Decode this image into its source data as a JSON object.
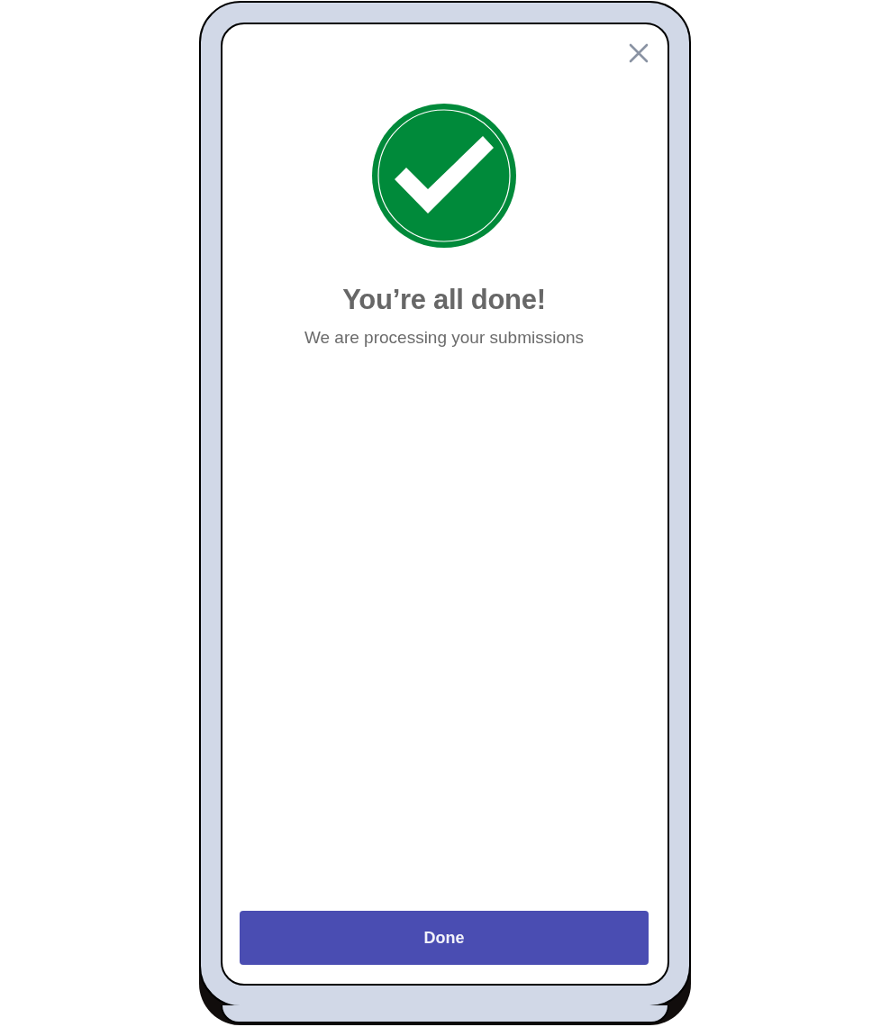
{
  "title": "You’re all done!",
  "message": "We are processing your submissions",
  "primary_button": {
    "label": "Done"
  }
}
